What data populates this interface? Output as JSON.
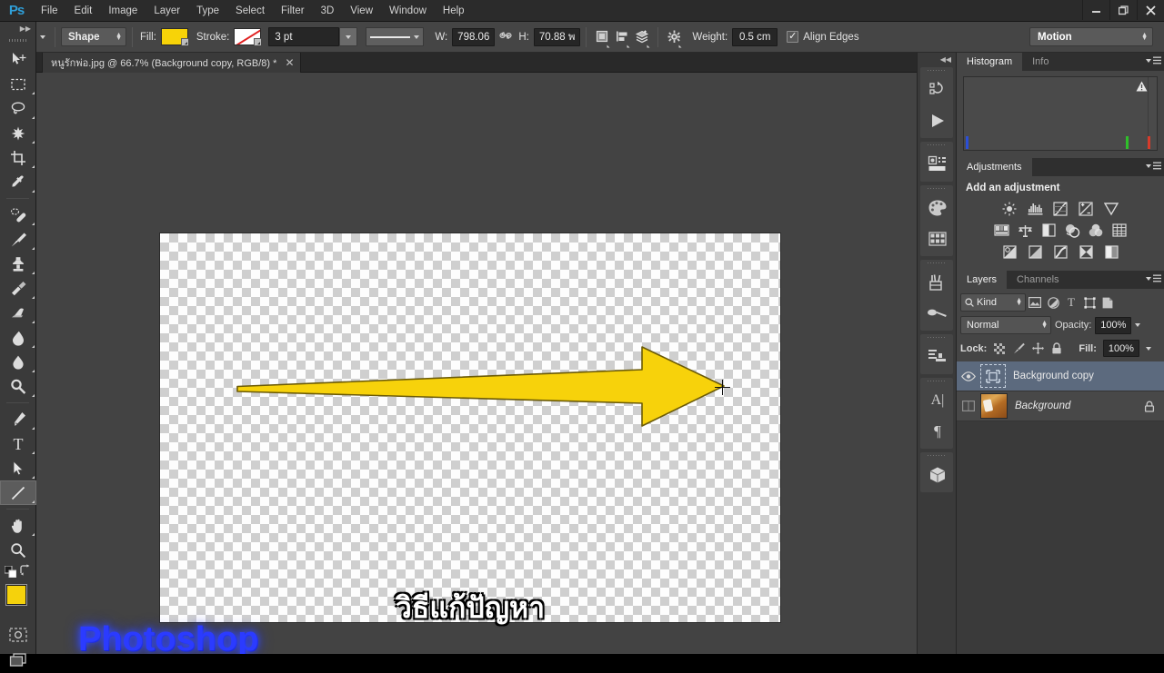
{
  "app": {
    "logo": "Ps",
    "menus": [
      "File",
      "Edit",
      "Image",
      "Layer",
      "Type",
      "Select",
      "Filter",
      "3D",
      "View",
      "Window",
      "Help"
    ],
    "window_controls": {
      "minimize": "—",
      "restore": "❐",
      "close": "✕"
    }
  },
  "options_bar": {
    "tool": "line-tool",
    "mode_label": "Shape",
    "fill_label": "Fill:",
    "fill_color": "#f7d308",
    "stroke_label": "Stroke:",
    "stroke_color": "none",
    "stroke_width": "3 pt",
    "stroke_style": "solid-line",
    "w_label": "W:",
    "w_value": "798.06",
    "link_icon": "∞",
    "h_label": "H:",
    "h_value": "70.88 พ",
    "path_op_icon": "path-operations-icon",
    "path_align_icon": "path-alignment-icon",
    "path_arrange_icon": "path-arrangement-icon",
    "gear_icon": "gear-icon",
    "weight_label": "Weight:",
    "weight_value": "0.5 cm",
    "align_edges_label": "Align Edges",
    "align_edges_checked": true,
    "workspace": "Motion"
  },
  "document": {
    "tab_title": "หนูรักพ่อ.jpg @ 66.7% (Background copy, RGB/8) *",
    "close_label": "✕",
    "caption": "วิธีแก้ปัญหา",
    "watermark": "Photoshop",
    "arrow_color": "#f7d20b",
    "arrow_stroke": "#6b5a06"
  },
  "tools": [
    {
      "name": "move-tool",
      "has_submenu": false,
      "selected": false
    },
    {
      "name": "rectangular-marquee-tool",
      "has_submenu": true,
      "selected": false
    },
    {
      "name": "lasso-tool",
      "has_submenu": true,
      "selected": false
    },
    {
      "name": "quick-selection-tool",
      "has_submenu": true,
      "selected": false
    },
    {
      "name": "crop-tool",
      "has_submenu": true,
      "selected": false
    },
    {
      "name": "eyedropper-tool",
      "has_submenu": true,
      "selected": false
    },
    {
      "name": "spot-healing-brush-tool",
      "has_submenu": true,
      "selected": false
    },
    {
      "name": "brush-tool",
      "has_submenu": true,
      "selected": false
    },
    {
      "name": "clone-stamp-tool",
      "has_submenu": true,
      "selected": false
    },
    {
      "name": "history-brush-tool",
      "has_submenu": true,
      "selected": false
    },
    {
      "name": "eraser-tool",
      "has_submenu": true,
      "selected": false
    },
    {
      "name": "gradient-tool",
      "has_submenu": true,
      "selected": false
    },
    {
      "name": "blur-tool",
      "has_submenu": true,
      "selected": false
    },
    {
      "name": "dodge-tool",
      "has_submenu": true,
      "selected": false
    },
    {
      "name": "pen-tool",
      "has_submenu": true,
      "selected": false
    },
    {
      "name": "type-tool",
      "has_submenu": true,
      "selected": false
    },
    {
      "name": "path-selection-tool",
      "has_submenu": true,
      "selected": false
    },
    {
      "name": "line-tool",
      "has_submenu": true,
      "selected": true
    },
    {
      "name": "hand-tool",
      "has_submenu": true,
      "selected": false
    },
    {
      "name": "zoom-tool",
      "has_submenu": false,
      "selected": false
    }
  ],
  "color_swatches": {
    "foreground": "#f5d20c",
    "background": "#ffffff",
    "default_colors_icon": "default-colors-icon",
    "swap_colors_icon": "swap-colors-icon",
    "quick_mask_icon": "quick-mask-icon",
    "screen_mode_icon": "screen-mode-icon"
  },
  "icon_dock": [
    {
      "name": "history-icon"
    },
    {
      "name": "actions-play-icon"
    },
    {
      "name": "properties-icon"
    },
    {
      "name": "color-palette-icon"
    },
    {
      "name": "swatches-grid-icon"
    },
    {
      "name": "brush-presets-icon"
    },
    {
      "name": "brush-settings-icon"
    },
    {
      "name": "adjustments-list-icon"
    },
    {
      "name": "character-icon"
    },
    {
      "name": "paragraph-icon"
    },
    {
      "name": "3d-cube-icon"
    }
  ],
  "panels": {
    "histogram": {
      "tabs": [
        "Histogram",
        "Info"
      ],
      "active_tab": "Histogram",
      "menu_icon": "panel-menu-icon",
      "warning_icon": "uncached-data-warning-icon",
      "bars": [
        {
          "name": "blue-bar",
          "color": "#2b4fd6",
          "left_pct": 1
        },
        {
          "name": "green-bar",
          "color": "#2fbf2a",
          "left_pct": 85
        },
        {
          "name": "red-bar",
          "color": "#d63b2b",
          "left_pct": 96
        }
      ]
    },
    "adjustments": {
      "tab": "Adjustments",
      "title": "Add an adjustment",
      "rows": [
        [
          "brightness-contrast-icon",
          "levels-icon",
          "curves-icon",
          "exposure-icon",
          "vibrance-icon"
        ],
        [
          "hue-saturation-icon",
          "color-balance-icon",
          "black-white-icon",
          "photo-filter-icon",
          "channel-mixer-icon",
          "color-lookup-icon"
        ],
        [
          "invert-icon",
          "posterize-icon",
          "threshold-icon",
          "selective-color-icon",
          "gradient-map-icon"
        ]
      ]
    },
    "layers": {
      "tabs": [
        "Layers",
        "Channels"
      ],
      "active_tab": "Layers",
      "filter_label": "Kind",
      "filter_icons": [
        "filter-pixel-icon",
        "filter-adjustment-icon",
        "filter-type-icon",
        "filter-shape-icon",
        "filter-smart-object-icon"
      ],
      "blend_mode": "Normal",
      "opacity_label": "Opacity:",
      "opacity_value": "100%",
      "lock_label": "Lock:",
      "lock_icons": [
        "lock-transparent-pixels-icon",
        "lock-image-pixels-icon",
        "lock-position-icon",
        "lock-all-icon"
      ],
      "fill_label": "Fill:",
      "fill_value": "100%",
      "items": [
        {
          "name": "Background copy",
          "selected": true,
          "visible": true,
          "locked": false,
          "thumb": "vector-shape-thumb",
          "italic": false
        },
        {
          "name": "Background",
          "selected": false,
          "visible": false,
          "locked": true,
          "thumb": "photo-thumb",
          "italic": true
        }
      ]
    }
  }
}
